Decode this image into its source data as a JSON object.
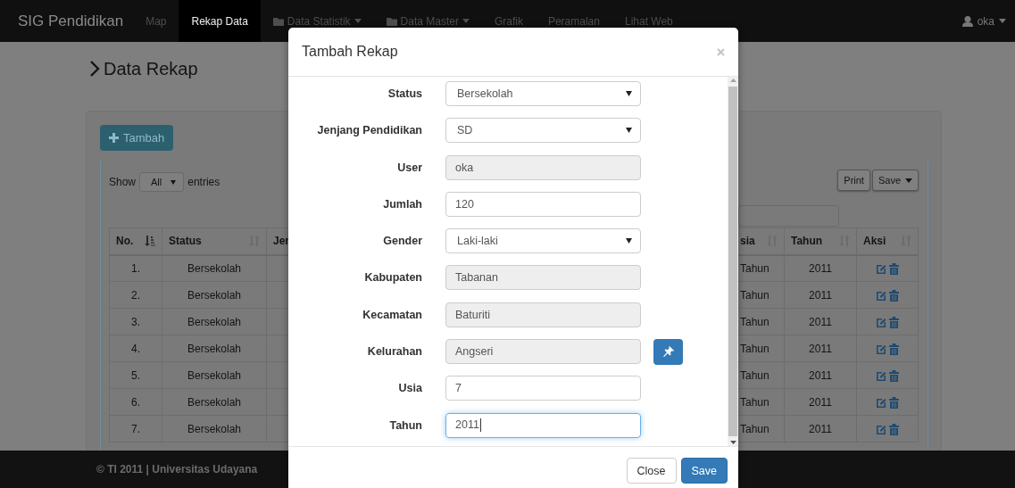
{
  "navbar": {
    "brand": "SIG Pendidikan",
    "items": [
      {
        "label": "Map",
        "selected": false,
        "dropdown": false
      },
      {
        "label": "Rekap Data",
        "selected": true,
        "dropdown": false
      },
      {
        "label": "Data Statistik",
        "selected": false,
        "dropdown": true
      },
      {
        "label": "Data Master",
        "selected": false,
        "dropdown": true
      },
      {
        "label": "Grafik",
        "selected": false,
        "dropdown": false
      },
      {
        "label": "Peramalan",
        "selected": false,
        "dropdown": false
      },
      {
        "label": "Lihat Web",
        "selected": false,
        "dropdown": false
      }
    ],
    "user": "oka"
  },
  "page": {
    "title": "Data Rekap",
    "add_button": "Tambah",
    "length": {
      "prefix": "Show",
      "value": "All",
      "suffix": "entries"
    },
    "buttons": [
      {
        "label": "Print",
        "dropdown": false
      },
      {
        "label": "Save",
        "dropdown": true
      }
    ],
    "table": {
      "columns": [
        {
          "label": "No.",
          "sorted": true
        },
        {
          "label": "Status",
          "sorted": false
        },
        {
          "label": "Jer"
        },
        {
          "label": "sia",
          "sorted": false
        },
        {
          "label": "Tahun",
          "sorted": false
        },
        {
          "label": "Aksi",
          "sorted": false
        }
      ],
      "rows": [
        {
          "no": "1.",
          "status": "Bersekolah",
          "column_4": "Tahun",
          "tahun": "2011"
        },
        {
          "no": "2.",
          "status": "Bersekolah",
          "column_4": "Tahun",
          "tahun": "2011"
        },
        {
          "no": "3.",
          "status": "Bersekolah",
          "column_4": "Tahun",
          "tahun": "2011"
        },
        {
          "no": "4.",
          "status": "Bersekolah",
          "column_4": "Tahun",
          "tahun": "2011"
        },
        {
          "no": "5.",
          "status": "Bersekolah",
          "column_4": "Tahun",
          "tahun": "2011"
        },
        {
          "no": "6.",
          "status": "Bersekolah",
          "column_4": "Tahun",
          "tahun": "2011"
        },
        {
          "no": "7.",
          "status": "Bersekolah",
          "column_4": "Tahun",
          "tahun": "2011"
        }
      ]
    }
  },
  "footer": "© TI 2011 | Universitas Udayana",
  "modal": {
    "title": "Tambah Rekap",
    "fields": [
      {
        "label": "Status",
        "kind": "select",
        "value": "Bersekolah",
        "focused": false
      },
      {
        "label": "Jenjang Pendidikan",
        "kind": "select",
        "value": "SD",
        "focused": false
      },
      {
        "label": "User",
        "kind": "readonly",
        "value": "oka",
        "focused": false
      },
      {
        "label": "Jumlah",
        "kind": "input",
        "value": "120",
        "focused": false
      },
      {
        "label": "Gender",
        "kind": "select",
        "value": "Laki-laki",
        "focused": false
      },
      {
        "label": "Kabupaten",
        "kind": "readonly",
        "value": "Tabanan",
        "focused": false
      },
      {
        "label": "Kecamatan",
        "kind": "readonly",
        "value": "Baturiti",
        "focused": false
      },
      {
        "label": "Kelurahan",
        "kind": "locate",
        "value": "Angseri",
        "focused": false
      },
      {
        "label": "Usia",
        "kind": "input",
        "value": "7",
        "focused": false
      },
      {
        "label": "Tahun",
        "kind": "input",
        "value": "2011",
        "focused": true
      }
    ],
    "buttons": [
      {
        "label": "Close",
        "kind": "default"
      },
      {
        "label": "Save",
        "kind": "primary"
      }
    ]
  }
}
